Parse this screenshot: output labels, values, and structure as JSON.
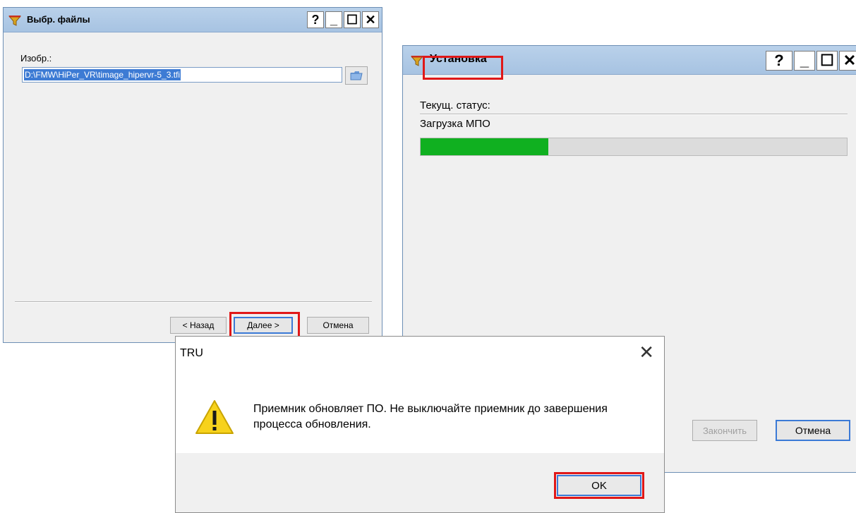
{
  "select_files_window": {
    "title": "Выбр. файлы",
    "title_buttons": [
      "?",
      "_",
      "☐",
      "✕"
    ],
    "image_label": "Изобр.:",
    "image_path": "D:\\FMW\\HiPer_VR\\timage_hipervr-5_3.tfi",
    "buttons": {
      "back": "< Назад",
      "next": "Далее >",
      "cancel": "Отмена"
    }
  },
  "install_window": {
    "title": "Установка",
    "title_buttons": [
      "?",
      "_",
      "☐",
      "✕"
    ],
    "status_label": "Текущ. статус:",
    "status_value": "Загрузка МПО",
    "progress_fraction": 0.3,
    "buttons": {
      "finish": "Закончить",
      "cancel": "Отмена"
    }
  },
  "message_dialog": {
    "title": "TRU",
    "close_glyph": "✕",
    "message": "Приемник обновляет ПО. Не выключайте приемник до завершения процесса обновления.",
    "ok_button": "OK"
  },
  "icons": {
    "app": "funnel-app-icon",
    "browse": "folder-open-icon",
    "warning": "warning-triangle-icon"
  },
  "colors": {
    "titlebar": "#b9d1ea",
    "highlight": "#e01818",
    "progress_fill": "#10b020",
    "selection": "#3d7bd4"
  }
}
